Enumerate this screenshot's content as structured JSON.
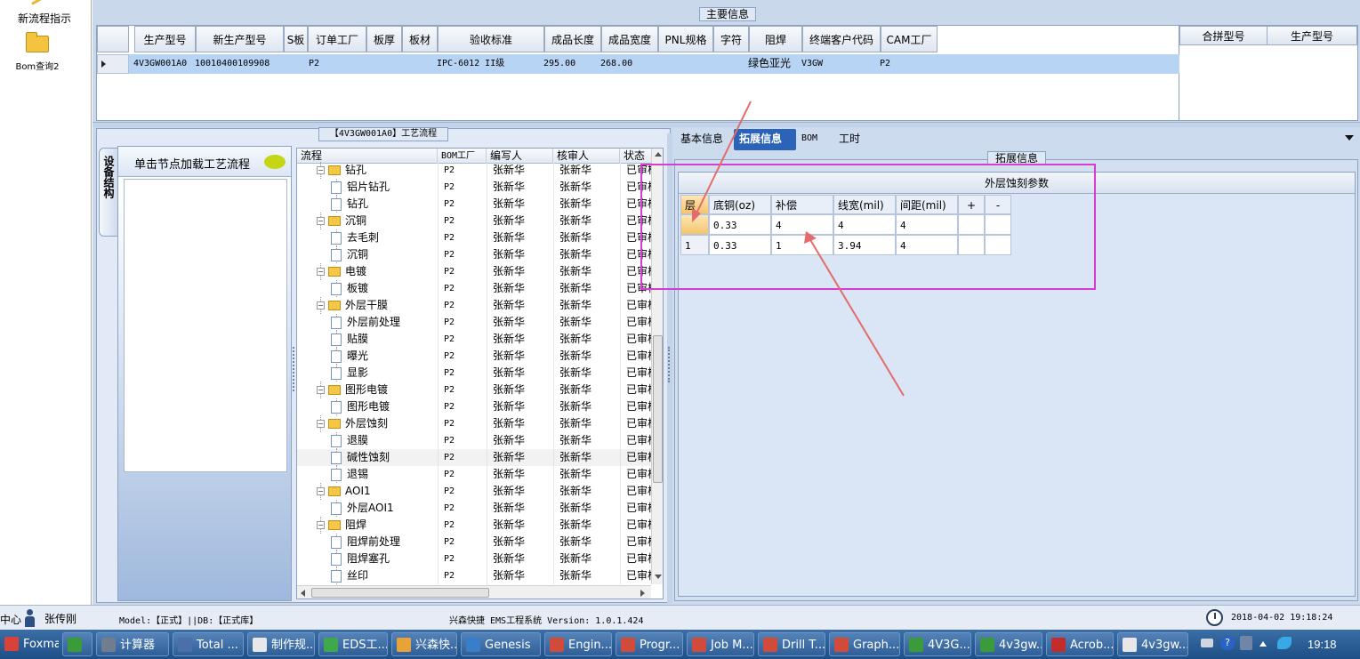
{
  "launcher": {
    "items": [
      {
        "label": "新流程指示"
      },
      {
        "label": "Bom查询2"
      }
    ]
  },
  "main_info": {
    "legend": "主要信息",
    "columns": [
      "生产型号",
      "新生产型号",
      "S板",
      "订单工厂",
      "板厚",
      "板材",
      "验收标准",
      "成品长度",
      "成品宽度",
      "PNL规格",
      "字符",
      "阻焊",
      "终端客户代码",
      "CAM工厂"
    ],
    "row": {
      "production_model": "4V3GW001A0",
      "new_production_model": "10010400109908",
      "s_board": "",
      "order_factory": "P2",
      "thickness": "",
      "material": "",
      "standard": "IPC-6012 II级",
      "length": "295.00",
      "width": "268.00",
      "pnl": "",
      "char": "",
      "solder_mask": "绿色亚光",
      "customer_code": "V3GW",
      "cam_factory": "P2"
    },
    "side_columns": [
      "合拼型号",
      "生产型号"
    ]
  },
  "process": {
    "legend": "【4V3GW001A0】工艺流程",
    "side_tab": "设备结构",
    "hint": "单击节点加载工艺流程",
    "columns": [
      "流程",
      "BOM工厂",
      "编写人",
      "核审人",
      "状态"
    ],
    "rows": [
      {
        "name": "钻孔",
        "level": 0,
        "factory": "P2",
        "writer": "张新华",
        "reviewer": "张新华",
        "status": "已审核"
      },
      {
        "name": "铝片钻孔",
        "level": 1,
        "factory": "P2",
        "writer": "张新华",
        "reviewer": "张新华",
        "status": "已审核"
      },
      {
        "name": "钻孔",
        "level": 1,
        "factory": "P2",
        "writer": "张新华",
        "reviewer": "张新华",
        "status": "已审核"
      },
      {
        "name": "沉铜",
        "level": 0,
        "factory": "P2",
        "writer": "张新华",
        "reviewer": "张新华",
        "status": "已审核"
      },
      {
        "name": "去毛刺",
        "level": 1,
        "factory": "P2",
        "writer": "张新华",
        "reviewer": "张新华",
        "status": "已审核"
      },
      {
        "name": "沉铜",
        "level": 1,
        "factory": "P2",
        "writer": "张新华",
        "reviewer": "张新华",
        "status": "已审核"
      },
      {
        "name": "电镀",
        "level": 0,
        "factory": "P2",
        "writer": "张新华",
        "reviewer": "张新华",
        "status": "已审核"
      },
      {
        "name": "板镀",
        "level": 1,
        "factory": "P2",
        "writer": "张新华",
        "reviewer": "张新华",
        "status": "已审核"
      },
      {
        "name": "外层干膜",
        "level": 0,
        "factory": "P2",
        "writer": "张新华",
        "reviewer": "张新华",
        "status": "已审核"
      },
      {
        "name": "外层前处理",
        "level": 1,
        "factory": "P2",
        "writer": "张新华",
        "reviewer": "张新华",
        "status": "已审核"
      },
      {
        "name": "贴膜",
        "level": 1,
        "factory": "P2",
        "writer": "张新华",
        "reviewer": "张新华",
        "status": "已审核"
      },
      {
        "name": "曝光",
        "level": 1,
        "factory": "P2",
        "writer": "张新华",
        "reviewer": "张新华",
        "status": "已审核"
      },
      {
        "name": "显影",
        "level": 1,
        "factory": "P2",
        "writer": "张新华",
        "reviewer": "张新华",
        "status": "已审核"
      },
      {
        "name": "图形电镀",
        "level": 0,
        "factory": "P2",
        "writer": "张新华",
        "reviewer": "张新华",
        "status": "已审核"
      },
      {
        "name": "图形电镀",
        "level": 1,
        "factory": "P2",
        "writer": "张新华",
        "reviewer": "张新华",
        "status": "已审核"
      },
      {
        "name": "外层蚀刻",
        "level": 0,
        "factory": "P2",
        "writer": "张新华",
        "reviewer": "张新华",
        "status": "已审核"
      },
      {
        "name": "退膜",
        "level": 1,
        "factory": "P2",
        "writer": "张新华",
        "reviewer": "张新华",
        "status": "已审核"
      },
      {
        "name": "碱性蚀刻",
        "level": 1,
        "factory": "P2",
        "writer": "张新华",
        "reviewer": "张新华",
        "status": "已审核"
      },
      {
        "name": "退锡",
        "level": 1,
        "factory": "P2",
        "writer": "张新华",
        "reviewer": "张新华",
        "status": "已审核"
      },
      {
        "name": "AOI1",
        "level": 0,
        "factory": "P2",
        "writer": "张新华",
        "reviewer": "张新华",
        "status": "已审核"
      },
      {
        "name": "外层AOI1",
        "level": 1,
        "factory": "P2",
        "writer": "张新华",
        "reviewer": "张新华",
        "status": "已审核"
      },
      {
        "name": "阻焊",
        "level": 0,
        "factory": "P2",
        "writer": "张新华",
        "reviewer": "张新华",
        "status": "已审核"
      },
      {
        "name": "阻焊前处理",
        "level": 1,
        "factory": "P2",
        "writer": "张新华",
        "reviewer": "张新华",
        "status": "已审核"
      },
      {
        "name": "阻焊塞孔",
        "level": 1,
        "factory": "P2",
        "writer": "张新华",
        "reviewer": "张新华",
        "status": "已审核"
      },
      {
        "name": "丝印",
        "level": 1,
        "factory": "P2",
        "writer": "张新华",
        "reviewer": "张新华",
        "status": "已审核"
      }
    ]
  },
  "detail": {
    "tabs": [
      "基本信息",
      "拓展信息",
      "BOM",
      "工时"
    ],
    "legend": "拓展信息",
    "table_title": "外层蚀刻参数",
    "columns": [
      "层",
      "底铜(oz)",
      "补偿",
      "线宽(mil)",
      "间距(mil)",
      "+",
      "-"
    ],
    "rows": [
      {
        "layer": "",
        "copper": "0.33",
        "comp": "4",
        "width": "4",
        "space": "4"
      },
      {
        "layer": "1",
        "copper": "0.33",
        "comp": "1",
        "width": "3.94",
        "space": "4"
      }
    ]
  },
  "status_bar": {
    "left_text": "中心",
    "user": "张传刚",
    "model_info": "Model:【正式】||DB:【正式库】",
    "system": "兴森快捷  EMS工程系统  Version: 1.0.1.424",
    "datetime": "2018-04-02 19:18:24"
  },
  "taskbar": {
    "items": [
      {
        "label": "Foxmail",
        "color": "#d9423b"
      },
      {
        "label": "",
        "color": "#3a9b3a"
      },
      {
        "label": "计算器",
        "color": "#6f7d8f"
      },
      {
        "label": "Total ...",
        "color": "#4b6fa8"
      },
      {
        "label": "制作规...",
        "color": "#e8e8e8"
      },
      {
        "label": "EDS工...",
        "color": "#3ea84a"
      },
      {
        "label": "兴森快...",
        "color": "#e8a23a"
      },
      {
        "label": "Genesis",
        "color": "#3a7ec9"
      },
      {
        "label": "Engin...",
        "color": "#d24a3a"
      },
      {
        "label": "Progr...",
        "color": "#d24a3a"
      },
      {
        "label": "Job M...",
        "color": "#d24a3a"
      },
      {
        "label": "Drill T...",
        "color": "#d24a3a"
      },
      {
        "label": "Graph...",
        "color": "#d24a3a"
      },
      {
        "label": "4V3G...",
        "color": "#3a9b3a"
      },
      {
        "label": "4v3gw...",
        "color": "#3a9b3a"
      },
      {
        "label": "Acrob...",
        "color": "#c42b2b"
      },
      {
        "label": "4v3gw...",
        "color": "#e8e8e8"
      }
    ],
    "clock": "19:18"
  }
}
